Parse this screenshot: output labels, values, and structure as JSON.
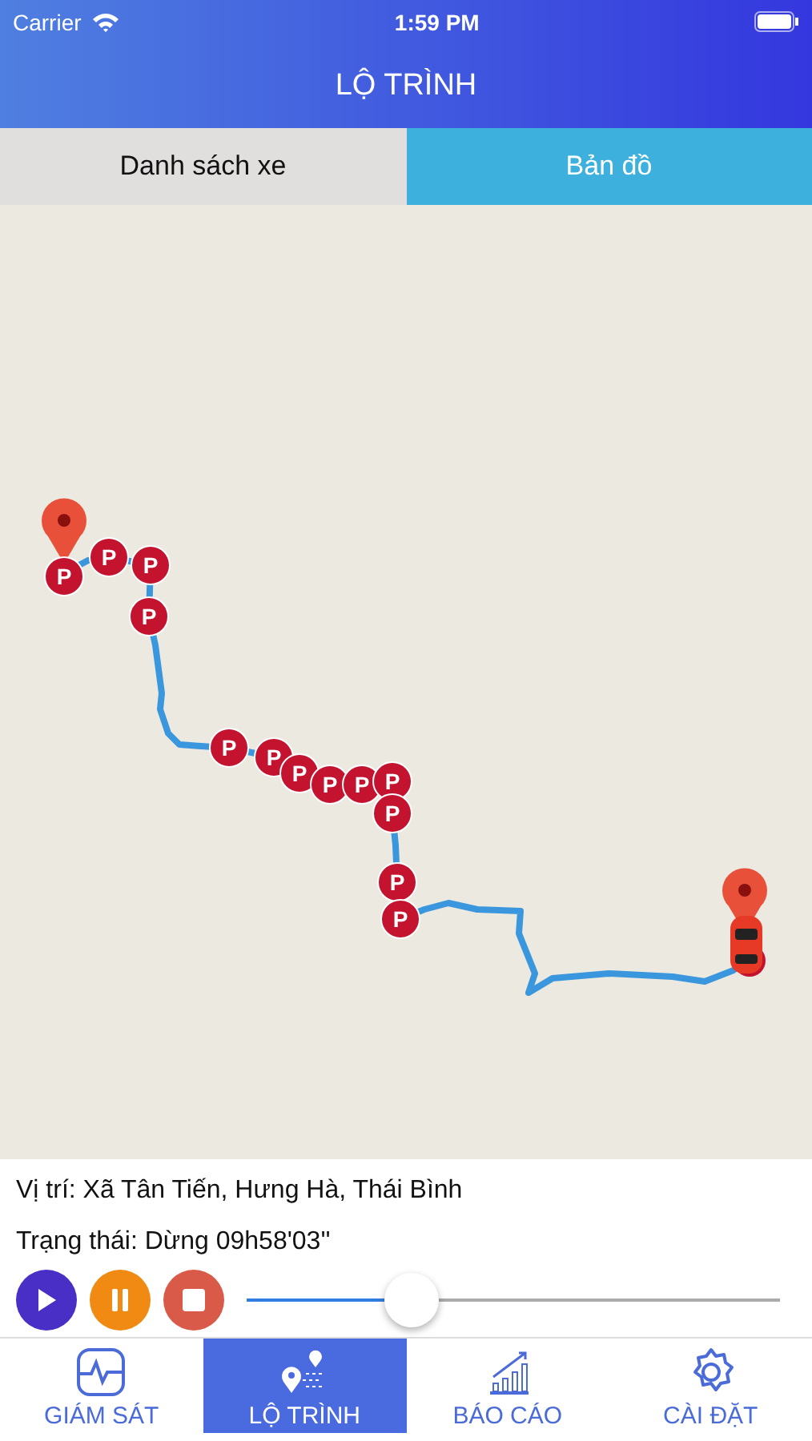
{
  "status_bar": {
    "carrier": "Carrier",
    "time": "1:59 PM"
  },
  "title": "LỘ TRÌNH",
  "tabs": [
    {
      "label": "Danh sách xe",
      "selected": false
    },
    {
      "label": "Bản đồ",
      "selected": true
    }
  ],
  "map": {
    "parking_markers": [
      {
        "label": "P"
      },
      {
        "label": "P"
      },
      {
        "label": "P"
      },
      {
        "label": "P"
      },
      {
        "label": "P"
      },
      {
        "label": "P"
      },
      {
        "label": "P"
      },
      {
        "label": "P"
      },
      {
        "label": "P"
      },
      {
        "label": "P"
      },
      {
        "label": "P"
      },
      {
        "label": "P"
      },
      {
        "label": "P"
      }
    ]
  },
  "info": {
    "location": "Vị trí: Xã Tân Tiến, Hưng Hà, Thái Bình",
    "status": "Trạng thái: Dừng  09h58'03''"
  },
  "player": {
    "level": 0.31
  },
  "bottom_tabs": [
    {
      "label": "GIÁM SÁT",
      "kind": "monitor",
      "selected": false
    },
    {
      "label": "LỘ TRÌNH",
      "kind": "route",
      "selected": true
    },
    {
      "label": "BÁO CÁO",
      "kind": "report",
      "selected": false
    },
    {
      "label": "CÀI ĐẶT",
      "kind": "settings",
      "selected": false
    }
  ]
}
